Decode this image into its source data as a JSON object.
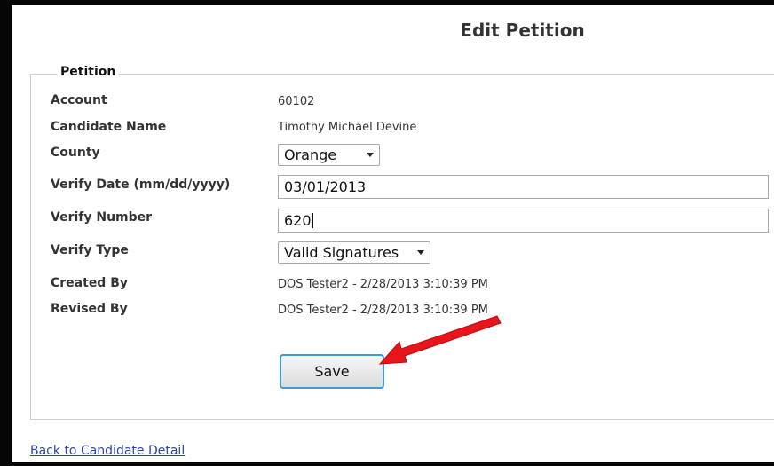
{
  "page": {
    "title": "Edit Petition"
  },
  "petition": {
    "legend": "Petition",
    "fields": {
      "account": {
        "label": "Account",
        "value": "60102"
      },
      "candidate_name": {
        "label": "Candidate Name",
        "value": "Timothy Michael Devine"
      },
      "county": {
        "label": "County",
        "selected": "Orange"
      },
      "verify_date": {
        "label": "Verify Date (mm/dd/yyyy)",
        "value": "03/01/2013"
      },
      "verify_number": {
        "label": "Verify Number",
        "value": "620"
      },
      "verify_type": {
        "label": "Verify Type",
        "selected": "Valid Signatures"
      },
      "created_by": {
        "label": "Created By",
        "value": "DOS Tester2 - 2/28/2013 3:10:39 PM"
      },
      "revised_by": {
        "label": "Revised By",
        "value": "DOS Tester2 - 2/28/2013 3:10:39 PM"
      }
    },
    "save_label": "Save"
  },
  "links": {
    "back": "Back to Candidate Detail"
  },
  "colors": {
    "annotation_arrow": "#e8151b",
    "link": "#2c45a8",
    "button_border": "#3d9bd6"
  }
}
